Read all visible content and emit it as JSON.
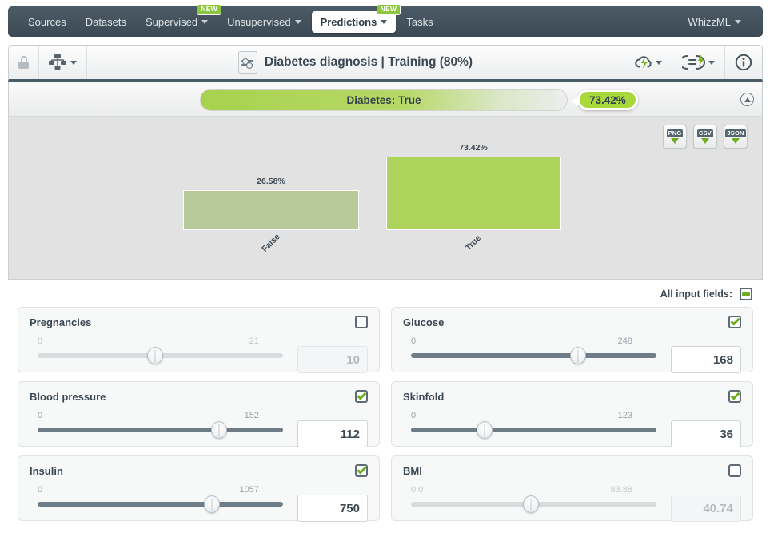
{
  "nav": {
    "items": [
      {
        "label": "Sources",
        "caret": false,
        "badge": "",
        "active": false
      },
      {
        "label": "Datasets",
        "caret": false,
        "badge": "",
        "active": false
      },
      {
        "label": "Supervised",
        "caret": true,
        "badge": "NEW",
        "active": false
      },
      {
        "label": "Unsupervised",
        "caret": true,
        "badge": "",
        "active": false
      },
      {
        "label": "Predictions",
        "caret": true,
        "badge": "NEW",
        "active": true
      },
      {
        "label": "Tasks",
        "caret": false,
        "badge": "",
        "active": false
      }
    ],
    "account": "WhizzML"
  },
  "toolbar": {
    "title": "Diabetes diagnosis | Training (80%)",
    "lock_icon": "lock-icon",
    "model_icon": "model-tree-icon",
    "title_icon": "prediction-sliders-icon",
    "batch_icon": "cloud-lightning-icon",
    "evaluate_icon": "equals-lightning-icon",
    "info_icon": "info-icon"
  },
  "prediction": {
    "label": "Diabetes: True",
    "probability": "73.42%",
    "collapse_icon": "collapse-up-icon"
  },
  "exports": [
    {
      "label": "PNG",
      "name": "download-png-button"
    },
    {
      "label": "CSV",
      "name": "download-csv-button"
    },
    {
      "label": "JSON",
      "name": "download-json-button"
    }
  ],
  "chart_data": {
    "type": "bar",
    "title": "",
    "xlabel": "",
    "ylabel": "",
    "categories": [
      "False",
      "True"
    ],
    "values": [
      26.58,
      73.42
    ],
    "value_labels": [
      "26.58%",
      "73.42%"
    ],
    "colors": [
      "#b8c99a",
      "#aed45d"
    ],
    "ylim": [
      0,
      100
    ],
    "grid": false,
    "legend": false
  },
  "inputs": {
    "all_fields_label": "All input fields:",
    "all_fields_state": "indeterminate",
    "fields": [
      {
        "name": "Pregnancies",
        "min": "0",
        "max": "21",
        "value": "10",
        "enabled": false,
        "pos": 48
      },
      {
        "name": "Glucose",
        "min": "0",
        "max": "248",
        "value": "168",
        "enabled": true,
        "pos": 68
      },
      {
        "name": "Blood pressure",
        "min": "0",
        "max": "152",
        "value": "112",
        "enabled": true,
        "pos": 74
      },
      {
        "name": "Skinfold",
        "min": "0",
        "max": "123",
        "value": "36",
        "enabled": true,
        "pos": 30
      },
      {
        "name": "Insulin",
        "min": "0",
        "max": "1057",
        "value": "750",
        "enabled": true,
        "pos": 71
      },
      {
        "name": "BMI",
        "min": "0.0",
        "max": "83.88",
        "value": "40.74",
        "enabled": false,
        "pos": 49
      }
    ]
  },
  "colors": {
    "brand_green": "#8dc63f",
    "bar_true": "#aed45d",
    "bar_false": "#b8c99a",
    "navbar": "#3c4a55"
  }
}
